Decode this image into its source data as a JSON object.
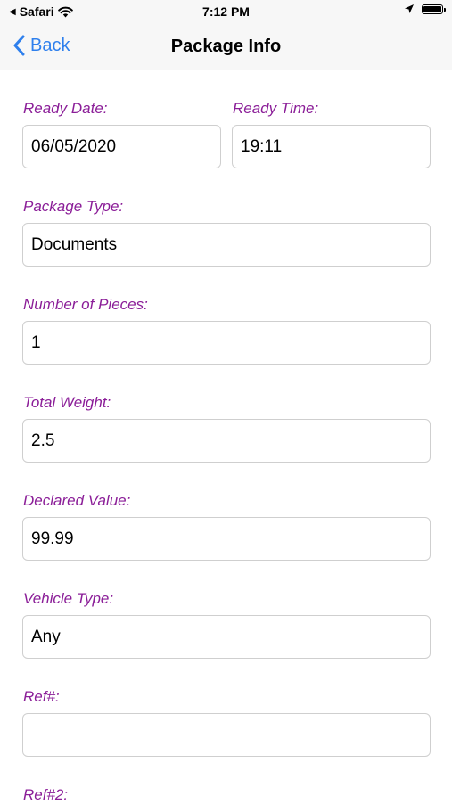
{
  "status_bar": {
    "carrier": "Safari",
    "time": "7:12 PM",
    "location_icon": "location-arrow-icon",
    "battery_icon": "battery-icon",
    "wifi_icon": "wifi-icon"
  },
  "nav": {
    "back_label": "Back",
    "title": "Package Info"
  },
  "form": {
    "ready_date": {
      "label": "Ready Date:",
      "value": "06/05/2020"
    },
    "ready_time": {
      "label": "Ready Time:",
      "value": "19:11"
    },
    "package_type": {
      "label": "Package Type:",
      "value": "Documents"
    },
    "number_of_pieces": {
      "label": "Number of Pieces:",
      "value": "1"
    },
    "total_weight": {
      "label": "Total Weight:",
      "value": "2.5"
    },
    "declared_value": {
      "label": "Declared Value:",
      "value": "99.99"
    },
    "vehicle_type": {
      "label": "Vehicle Type:",
      "value": "Any"
    },
    "ref1": {
      "label": "Ref#:",
      "value": ""
    },
    "ref2": {
      "label": "Ref#2:"
    }
  },
  "colors": {
    "label": "#8b1e98",
    "link": "#2f80ed",
    "border": "#cfcfcf"
  }
}
